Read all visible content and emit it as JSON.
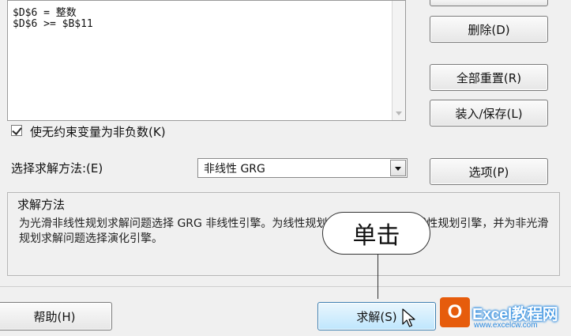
{
  "constraints": {
    "lines": [
      "$D$6 = 整数",
      "$D$6 >= $B$11"
    ]
  },
  "buttons": {
    "delete": "删除(D)",
    "reset_all": "全部重置(R)",
    "load_save": "装入/保存(L)",
    "options": "选项(P)",
    "help": "帮助(H)",
    "solve": "求解(S)"
  },
  "nonneg_checkbox": {
    "label": "使无约束变量为非负数(K)",
    "checked": true
  },
  "method": {
    "label": "选择求解方法:(E)",
    "selected": "非线性 GRG"
  },
  "description": {
    "title": "求解方法",
    "text": "为光滑非线性规划求解问题选择 GRG 非线性引擎。为线性规划求解问题选择单纯线性规划引擎，并为非光滑规划求解问题选择演化引擎。"
  },
  "callout": {
    "text": "单击"
  },
  "watermark": {
    "logo_letter": "O",
    "title": "Excel教程网",
    "url": "www.excelcw.com"
  },
  "icons": {
    "cursor": "mouse-pointer-icon",
    "logo": "office-logo-icon"
  }
}
